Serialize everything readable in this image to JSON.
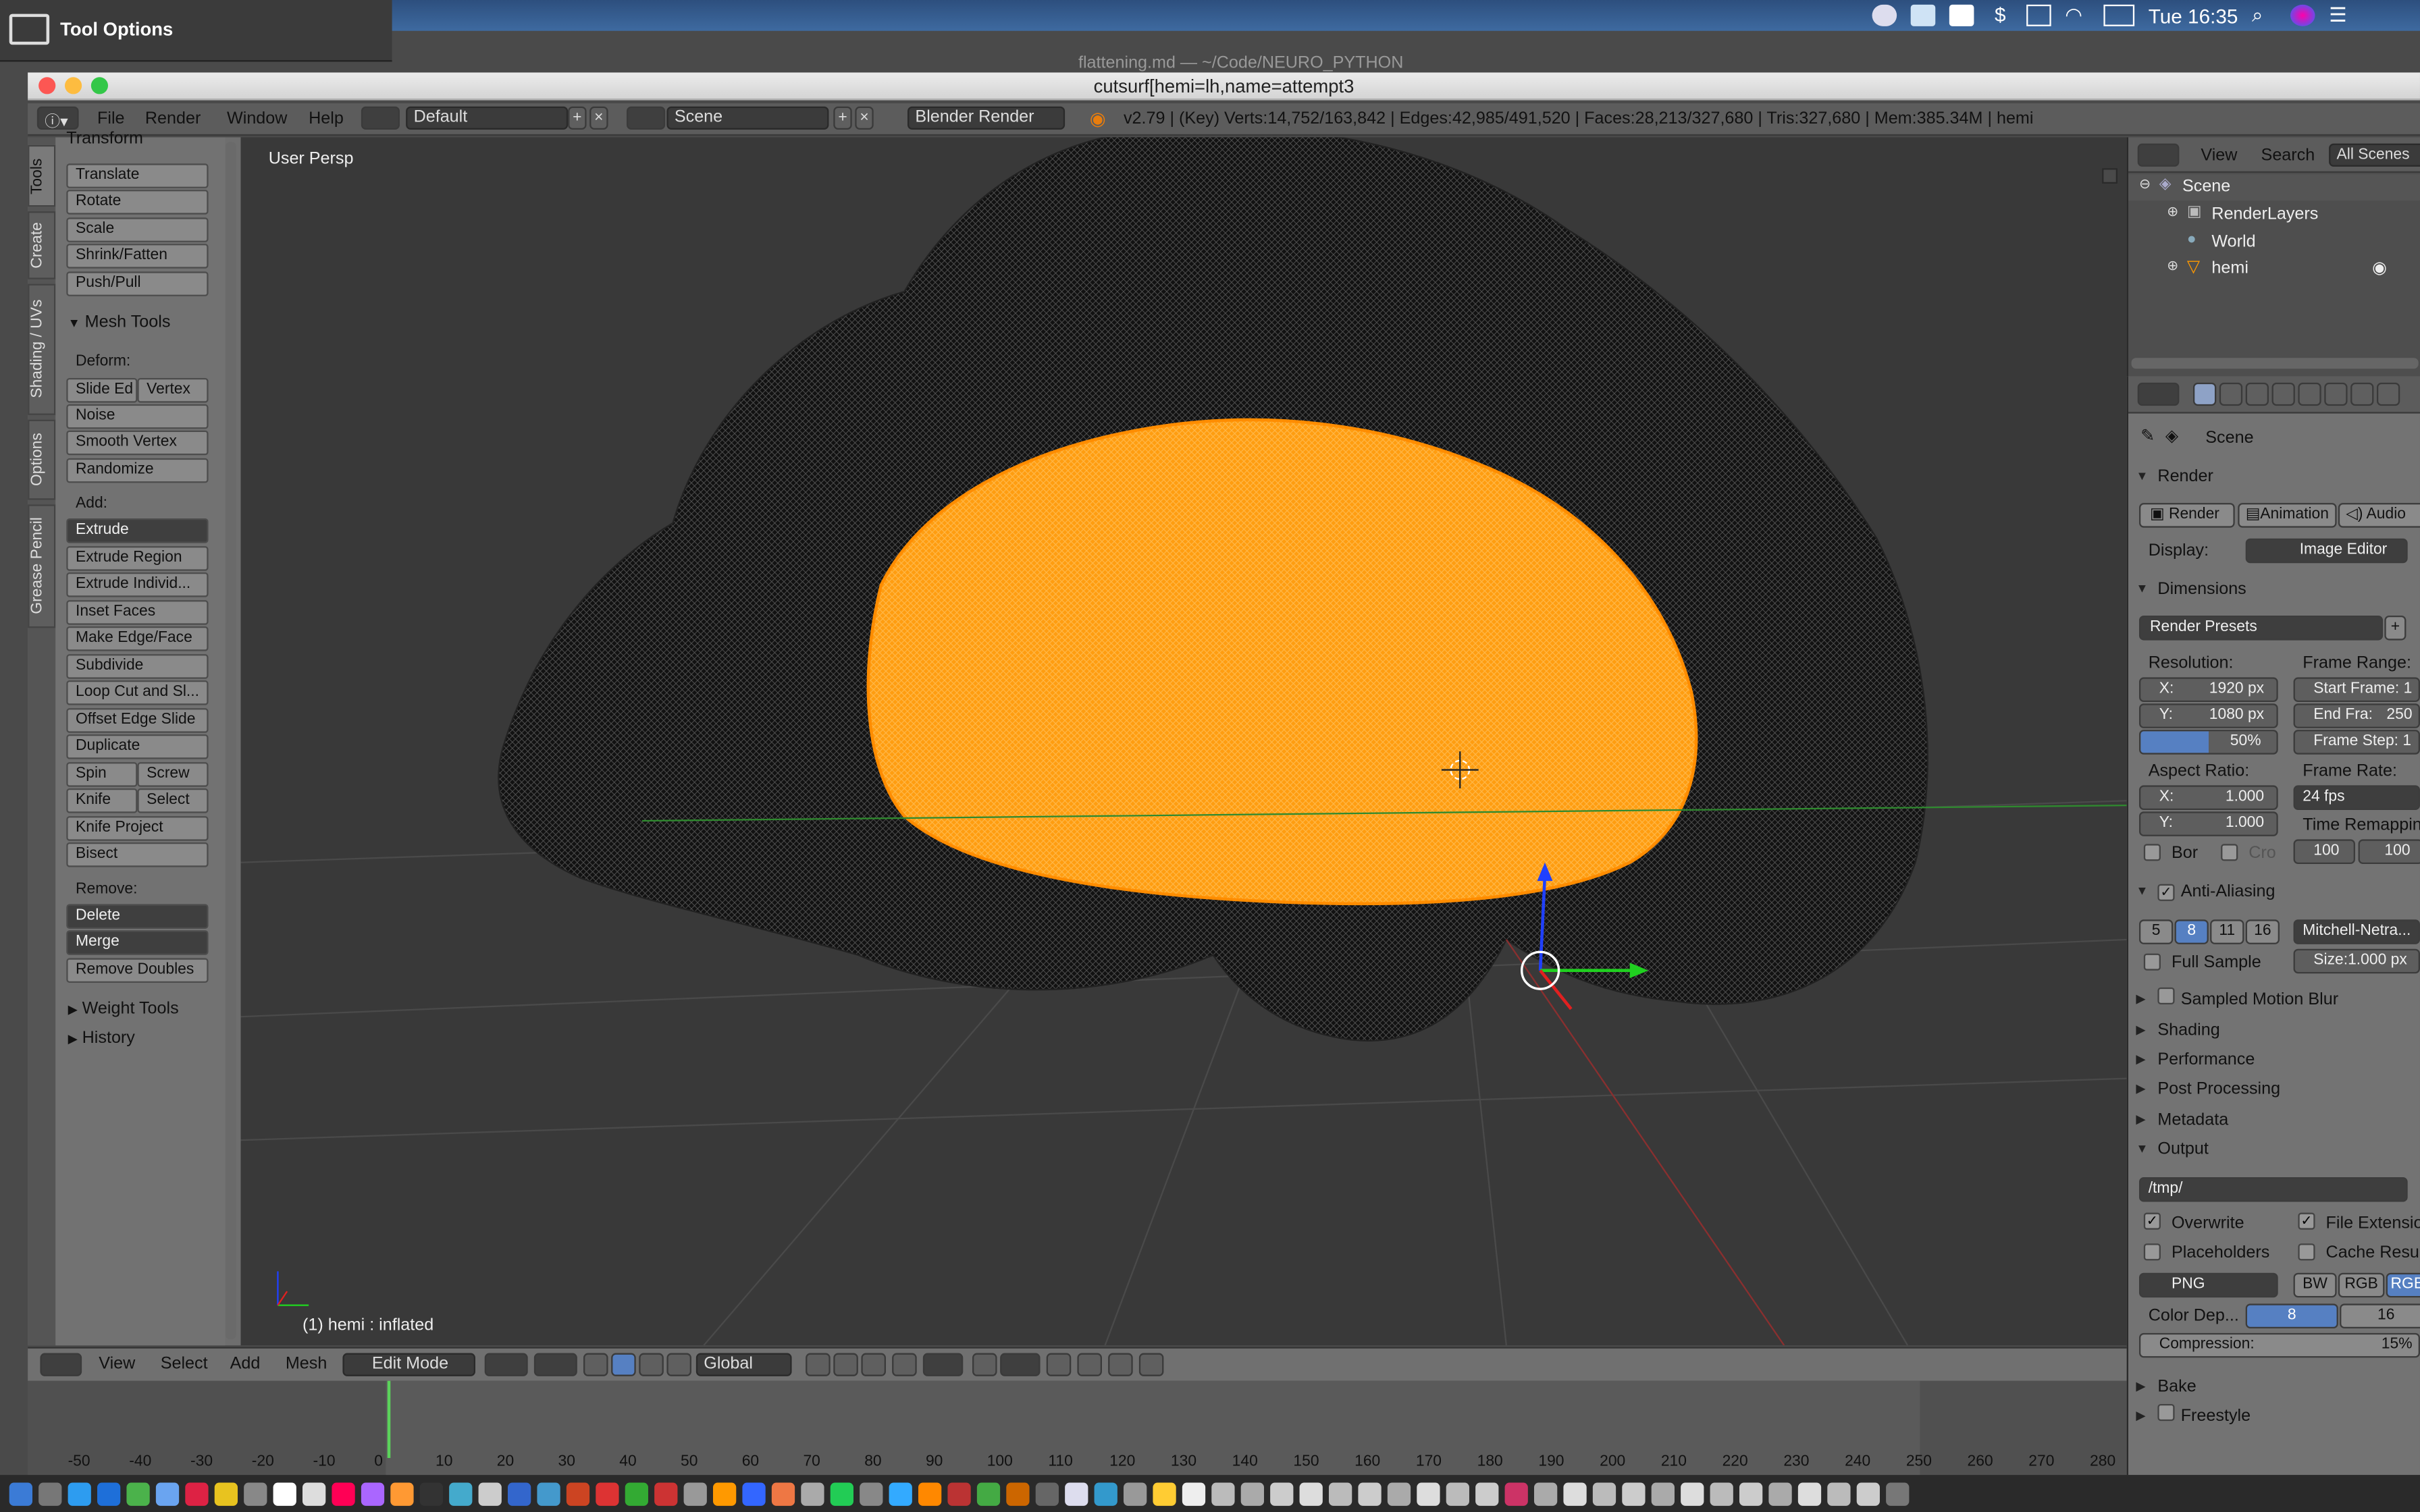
{
  "macos": {
    "tool_options": "Tool Options",
    "clock": "Tue 16:35",
    "bg_window_title": "flattening.md — ~/Code/NEURO_PYTHON"
  },
  "window": {
    "title": "cutsurf[hemi=lh,name=attempt3"
  },
  "infobar": {
    "menus": [
      "File",
      "Render",
      "Window",
      "Help"
    ],
    "layout": "Default",
    "scene": "Scene",
    "engine": "Blender Render",
    "stats": "v2.79 | (Key) Verts:14,752/163,842 | Edges:42,985/491,520 | Faces:28,213/327,680 | Tris:327,680 | Mem:385.34M | hemi"
  },
  "tool_tabs": [
    "Tools",
    "Create",
    "Shading / UVs",
    "Options",
    "Grease Pencil"
  ],
  "toolshelf": {
    "transform_header": "Transform",
    "transform": [
      "Translate",
      "Rotate",
      "Scale",
      "Shrink/Fatten",
      "Push/Pull"
    ],
    "mesh_tools_header": "Mesh Tools",
    "deform_label": "Deform:",
    "slide_edge": "Slide Ed",
    "vertex": "Vertex",
    "deform": [
      "Noise",
      "Smooth Vertex",
      "Randomize"
    ],
    "add_label": "Add:",
    "extrude": "Extrude",
    "add": [
      "Extrude Region",
      "Extrude Individ...",
      "Inset Faces",
      "Make Edge/Face",
      "Subdivide",
      "Loop Cut and Sl...",
      "Offset Edge Slide",
      "Duplicate"
    ],
    "spin": "Spin",
    "screw": "Screw",
    "knife": "Knife",
    "select": "Select",
    "add2": [
      "Knife Project",
      "Bisect"
    ],
    "remove_label": "Remove:",
    "delete": "Delete",
    "merge": "Merge",
    "remove_doubles": "Remove Doubles",
    "weight_tools": "Weight Tools",
    "history": "History"
  },
  "viewport": {
    "persp_label": "User Persp",
    "object_label": "(1) hemi : inflated"
  },
  "view_header": {
    "menus": [
      "View",
      "Select",
      "Add",
      "Mesh"
    ],
    "mode": "Edit Mode",
    "orientation": "Global"
  },
  "timeline": {
    "ticks": [
      "-50",
      "-40",
      "-30",
      "-20",
      "-10",
      "0",
      "10",
      "20",
      "30",
      "40",
      "50",
      "60",
      "70",
      "80",
      "90",
      "100",
      "110",
      "120",
      "130",
      "140",
      "150",
      "160",
      "170",
      "180",
      "190",
      "200",
      "210",
      "220",
      "230",
      "240",
      "250",
      "260",
      "270",
      "280"
    ]
  },
  "outliner": {
    "menus": [
      "View",
      "Search"
    ],
    "all_scenes": "All Scenes",
    "tree": [
      "Scene",
      "RenderLayers",
      "World",
      "hemi"
    ]
  },
  "properties": {
    "scene": "Scene",
    "render_header": "Render",
    "render_btn": "Render",
    "animation_btn": "Animation",
    "audio_btn": "Audio",
    "display_label": "Display:",
    "display_value": "Image Editor",
    "dimensions_header": "Dimensions",
    "render_presets": "Render Presets",
    "resolution_label": "Resolution:",
    "res_x": "X:",
    "res_x_val": "1920 px",
    "res_y": "Y:",
    "res_y_val": "1080 px",
    "res_pct": "50%",
    "frame_range_label": "Frame Range:",
    "start_frame": "Start Frame: 1",
    "end_frame_label": "End Fra:",
    "end_frame_val": "250",
    "frame_step": "Frame Step: 1",
    "aspect_label": "Aspect Ratio:",
    "asp_x": "X:",
    "asp_x_val": "1.000",
    "asp_y": "Y:",
    "asp_y_val": "1.000",
    "frame_rate_label": "Frame Rate:",
    "fps": "24 fps",
    "time_remap": "Time Remapping",
    "bor": "Bor",
    "cro": "Cro",
    "remap_old": "100",
    "remap_new": "100",
    "aa_header": "Anti-Aliasing",
    "aa_samples": [
      "5",
      "8",
      "11",
      "16"
    ],
    "aa_filter": "Mitchell-Netra...",
    "full_sample": "Full Sample",
    "aa_size": "Size:1.000 px",
    "motion_blur": "Sampled Motion Blur",
    "shading": "Shading",
    "performance": "Performance",
    "post_processing": "Post Processing",
    "metadata": "Metadata",
    "output_header": "Output",
    "output_path": "/tmp/",
    "overwrite": "Overwrite",
    "file_ext": "File Extensio...",
    "placeholders": "Placeholders",
    "cache_result": "Cache Result",
    "format": "PNG",
    "bw": "BW",
    "rgb": "RGB",
    "rgba": "RGBA",
    "color_depth_label": "Color Dep...",
    "depth8": "8",
    "depth16": "16",
    "compression": "Compression:",
    "compression_val": "15%",
    "bake": "Bake",
    "freestyle": "Freestyle"
  }
}
